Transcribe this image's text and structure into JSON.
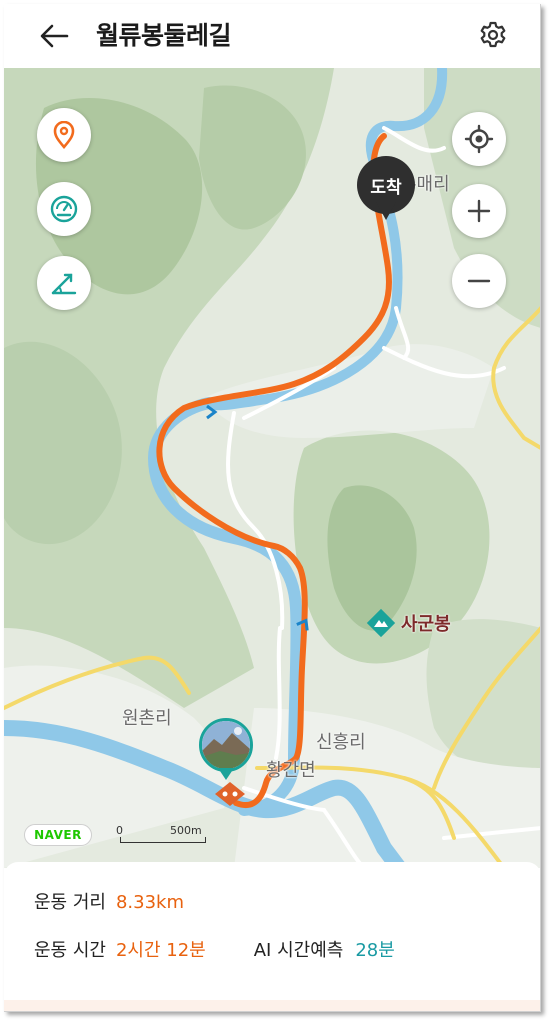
{
  "header": {
    "title": "월류봉둘레길",
    "back_icon": "back-arrow-icon",
    "settings_icon": "gear-icon"
  },
  "map": {
    "labels": {
      "village_top": "우매리",
      "village_left": "원촌리",
      "village_right": "신흥리",
      "town": "황간면",
      "mountain": "사군봉"
    },
    "arrival_marker": "도착",
    "attribution": "NAVER",
    "scale": {
      "start": "0",
      "end": "500m"
    },
    "buttons": {
      "left": [
        "location-pin-icon",
        "speedometer-icon",
        "slope-icon"
      ],
      "right": [
        "my-location-icon",
        "zoom-in-icon",
        "zoom-out-icon"
      ]
    },
    "colors": {
      "route": "#f26b1d",
      "river": "#8fc8e8",
      "terrain": "#dfe7da",
      "forest": "#b9cfae",
      "road_major": "#f4d96a"
    }
  },
  "stats": {
    "distance_label": "운동 거리",
    "distance_value": "8.33km",
    "time_label": "운동 시간",
    "time_value": "2시간 12분",
    "ai_label": "AI 시간예측",
    "ai_value": "28분"
  }
}
